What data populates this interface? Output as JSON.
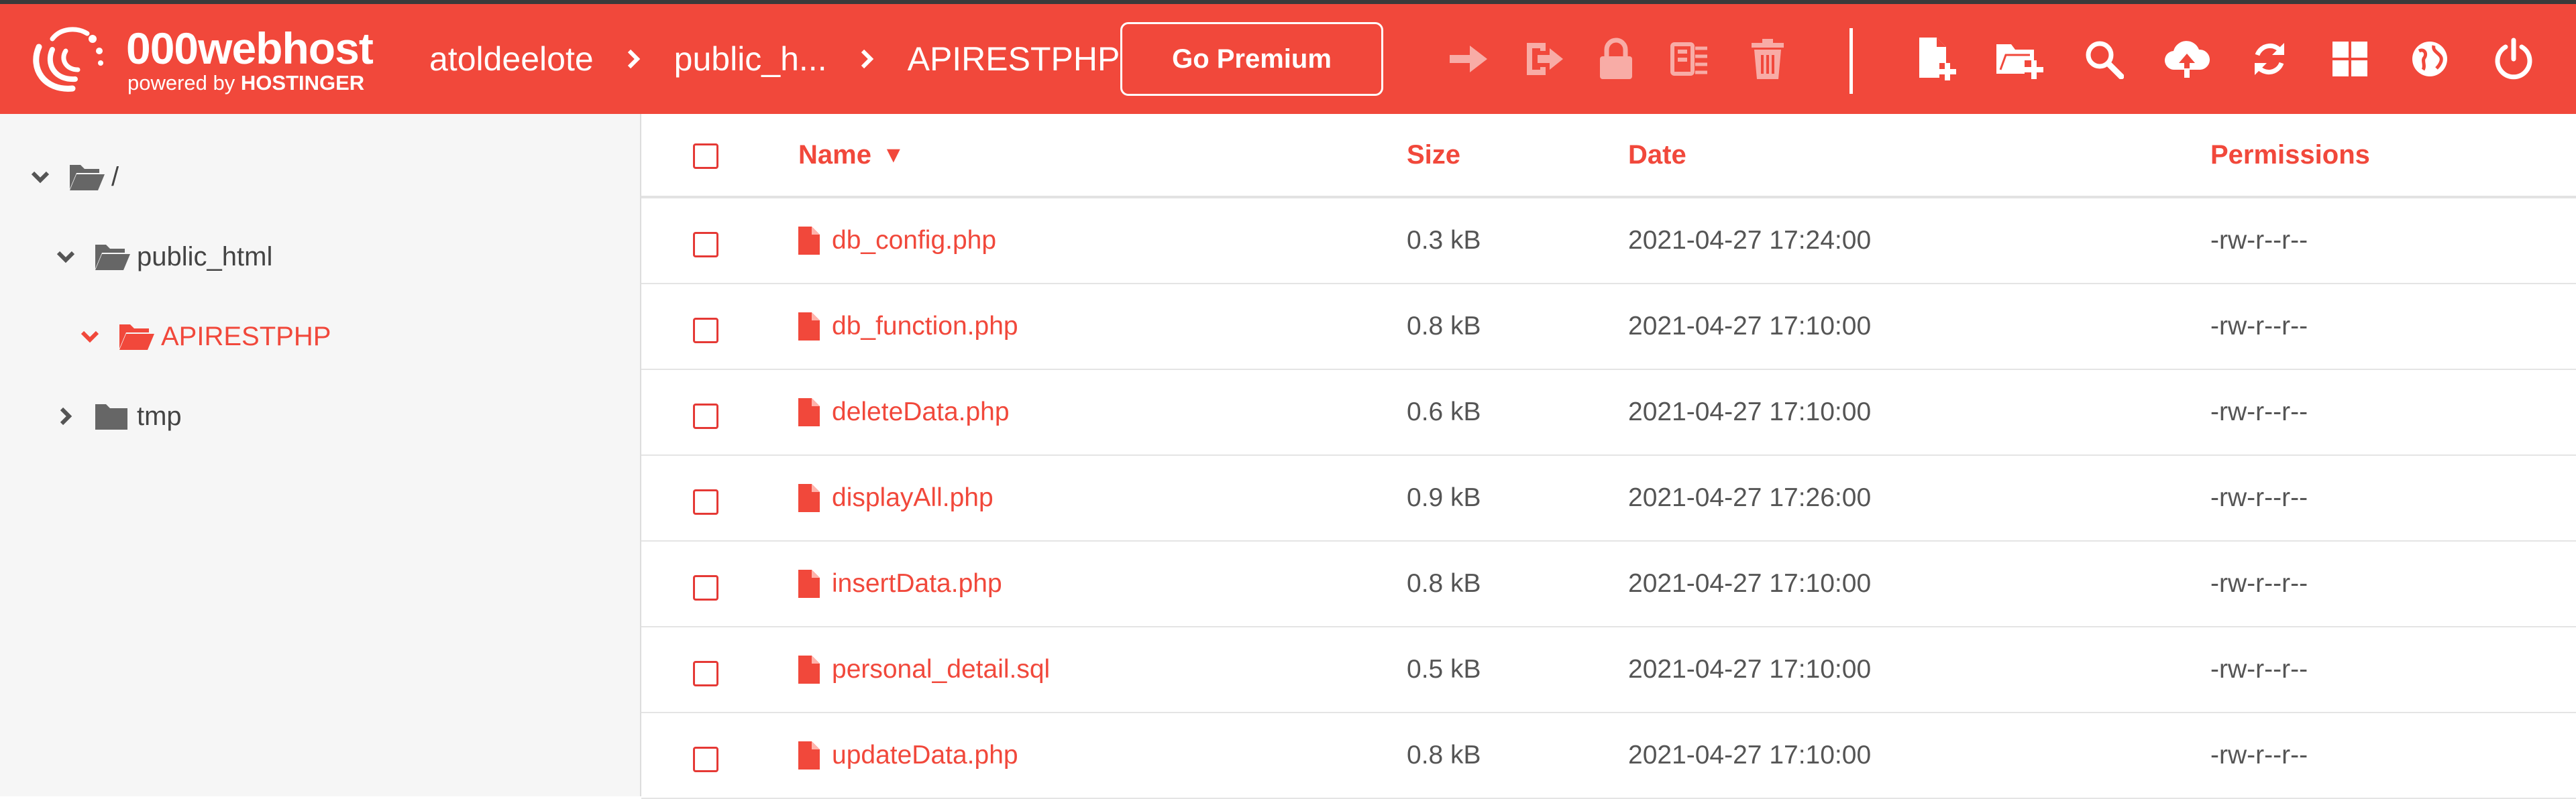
{
  "header": {
    "logo_title": "000webhost",
    "logo_sub_prefix": "powered by ",
    "logo_sub_brand": "HOSTINGER",
    "breadcrumbs": [
      "atoldeelote",
      "public_h...",
      "APIRESTPHP"
    ],
    "premium_label": "Go Premium",
    "colors": {
      "bar": "#f1483b",
      "text": "#ffffff"
    },
    "toolbar_icons": [
      "move-icon",
      "rename-icon",
      "lock-icon",
      "archive-icon",
      "delete-icon",
      "new-file-icon",
      "new-folder-icon",
      "search-icon",
      "upload-icon",
      "refresh-icon",
      "view-grid-icon",
      "globe-icon",
      "power-icon"
    ]
  },
  "sidebar": {
    "tree": [
      {
        "label": "/",
        "expanded": true,
        "active": false
      },
      {
        "label": "public_html",
        "expanded": true,
        "active": false
      },
      {
        "label": "APIRESTPHP",
        "expanded": true,
        "active": true
      },
      {
        "label": "tmp",
        "expanded": false,
        "active": false
      }
    ]
  },
  "table": {
    "columns": {
      "name": "Name",
      "size": "Size",
      "date": "Date",
      "permissions": "Permissions"
    },
    "sort_indicator": "▼",
    "rows": [
      {
        "name": "db_config.php",
        "size": "0.3 kB",
        "date": "2021-04-27 17:24:00",
        "perms": "-rw-r--r--"
      },
      {
        "name": "db_function.php",
        "size": "0.8 kB",
        "date": "2021-04-27 17:10:00",
        "perms": "-rw-r--r--"
      },
      {
        "name": "deleteData.php",
        "size": "0.6 kB",
        "date": "2021-04-27 17:10:00",
        "perms": "-rw-r--r--"
      },
      {
        "name": "displayAll.php",
        "size": "0.9 kB",
        "date": "2021-04-27 17:26:00",
        "perms": "-rw-r--r--"
      },
      {
        "name": "insertData.php",
        "size": "0.8 kB",
        "date": "2021-04-27 17:10:00",
        "perms": "-rw-r--r--"
      },
      {
        "name": "personal_detail.sql",
        "size": "0.5 kB",
        "date": "2021-04-27 17:10:00",
        "perms": "-rw-r--r--"
      },
      {
        "name": "updateData.php",
        "size": "0.8 kB",
        "date": "2021-04-27 17:10:00",
        "perms": "-rw-r--r--"
      }
    ]
  }
}
